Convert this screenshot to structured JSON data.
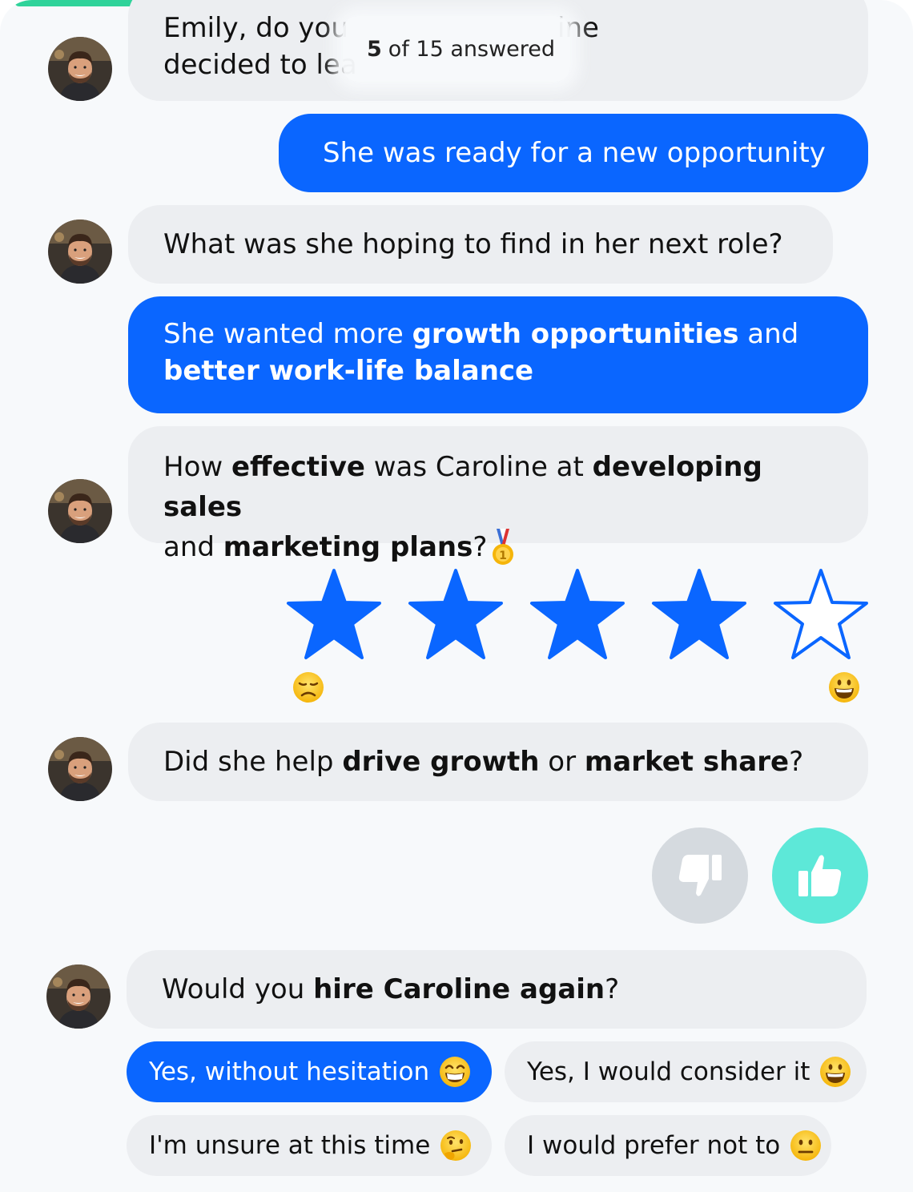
{
  "progress": {
    "answered": "5",
    "total_text": "of 15 answered",
    "fraction": 0.333
  },
  "messages": [
    {
      "line1": "Emily, do you",
      "line1_tail": "ine",
      "line2": "decided to lea"
    },
    {
      "text": "She was ready for a new opportunity"
    },
    {
      "text": "What was she hoping to find in her next role?"
    },
    {
      "p1": "She wanted more ",
      "b1": "growth opportunities",
      "p2": " and",
      "b2": "better work-life balance"
    },
    {
      "p1": "How ",
      "b1": "effective",
      "p2": " was Caroline at ",
      "b2": "developing sales",
      "p3": "and ",
      "b3": "marketing plans",
      "p4": "?"
    },
    {
      "p1": "Did she help ",
      "b1": "drive growth",
      "p2": " or ",
      "b2": "market share",
      "p3": "?"
    },
    {
      "p1": "Would you ",
      "b1": "hire Caroline again",
      "p2": "?"
    }
  ],
  "rating": {
    "value": 4,
    "max": 5,
    "low_emoji": "disappointed-face-icon",
    "high_emoji": "grinning-face-icon"
  },
  "thumbs": {
    "selected": "up",
    "down_color": "#d5dadf",
    "up_color": "#5de8d8"
  },
  "choices": [
    {
      "label": "Yes, without hesitation",
      "emoji": "beaming-face-icon",
      "selected": true
    },
    {
      "label": "Yes, I would consider it",
      "emoji": "grinning-face-icon",
      "selected": false
    },
    {
      "label": "I'm unsure at this time",
      "emoji": "thinking-face-icon",
      "selected": false
    },
    {
      "label": "I would prefer not to",
      "emoji": "neutral-face-icon",
      "selected": false
    }
  ],
  "colors": {
    "accent": "#0a66ff",
    "progress": "#2fd39a",
    "bot_bubble": "#eceef1",
    "background": "#f7f9fb"
  }
}
